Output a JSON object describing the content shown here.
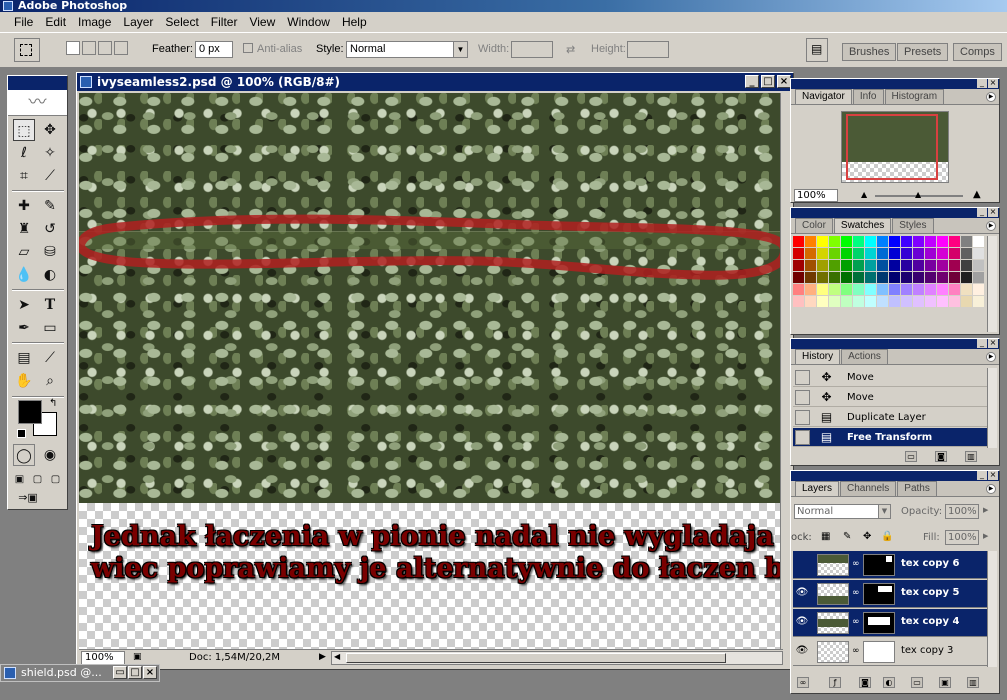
{
  "app": {
    "title": "Adobe Photoshop"
  },
  "menu": [
    "File",
    "Edit",
    "Image",
    "Layer",
    "Select",
    "Filter",
    "View",
    "Window",
    "Help"
  ],
  "options": {
    "feather_label": "Feather:",
    "feather_value": "0 px",
    "antialias_label": "Anti-alias",
    "style_label": "Style:",
    "style_value": "Normal",
    "width_label": "Width:",
    "height_label": "Height:",
    "well_tabs": [
      "Brushes",
      "Presets",
      "Comps"
    ]
  },
  "document": {
    "title": "ivyseamless2.psd @ 100% (RGB/8#)",
    "caption_line1": "Jednak łaczenia w pionie nadal nie wygladaja dobrze",
    "caption_line2": "wiec poprawiamy je alternatywnie do łaczen bocznych",
    "zoom": "100%",
    "doc_info": "Doc: 1,54M/20,2M"
  },
  "navigator": {
    "tabs": [
      "Navigator",
      "Info",
      "Histogram"
    ],
    "zoom": "100%"
  },
  "swatches": {
    "tabs": [
      "Color",
      "Swatches",
      "Styles"
    ],
    "colors": [
      "#ff0000",
      "#ff8000",
      "#ffff00",
      "#80ff00",
      "#00ff00",
      "#00ff80",
      "#00ffff",
      "#0080ff",
      "#0000ff",
      "#4000ff",
      "#8000ff",
      "#c000ff",
      "#ff00ff",
      "#ff0080",
      "#808080",
      "#ffffff",
      "#d40000",
      "#d46a00",
      "#d4d400",
      "#6ad400",
      "#00d400",
      "#00d46a",
      "#00d4d4",
      "#006ad4",
      "#0000d4",
      "#3500d4",
      "#6a00d4",
      "#a000d4",
      "#d400d4",
      "#d4006a",
      "#606060",
      "#e0e0e0",
      "#a00000",
      "#a05000",
      "#a0a000",
      "#50a000",
      "#00a000",
      "#00a050",
      "#00a0a0",
      "#0050a0",
      "#0000a0",
      "#2800a0",
      "#5000a0",
      "#7800a0",
      "#a000a0",
      "#a00050",
      "#404040",
      "#c0c0c0",
      "#700000",
      "#703800",
      "#707000",
      "#387000",
      "#007000",
      "#007038",
      "#007070",
      "#003870",
      "#000070",
      "#1c0070",
      "#380070",
      "#540070",
      "#700070",
      "#700038",
      "#202020",
      "#a0a0a0",
      "#ff8080",
      "#ffb080",
      "#ffff80",
      "#c0ff80",
      "#80ff80",
      "#80ffc0",
      "#80ffff",
      "#80c0ff",
      "#8080ff",
      "#a080ff",
      "#c080ff",
      "#e080ff",
      "#ff80ff",
      "#ff80c0",
      "#f0e0c0",
      "#fff0e0",
      "#ffc0c0",
      "#ffd8c0",
      "#ffffc0",
      "#e0ffc0",
      "#c0ffc0",
      "#c0ffe0",
      "#c0ffff",
      "#c0e0ff",
      "#c0c0ff",
      "#d0c0ff",
      "#e0c0ff",
      "#f0c0ff",
      "#ffc0ff",
      "#ffc0e0",
      "#e8d8b0",
      "#f8f0d8"
    ]
  },
  "history": {
    "tabs": [
      "History",
      "Actions"
    ],
    "items": [
      {
        "label": "Move",
        "selected": false
      },
      {
        "label": "Move",
        "selected": false
      },
      {
        "label": "Duplicate Layer",
        "selected": false
      },
      {
        "label": "Free Transform",
        "selected": true
      }
    ]
  },
  "layers": {
    "tabs": [
      "Layers",
      "Channels",
      "Paths"
    ],
    "blend_mode": "Normal",
    "opacity_label": "Opacity:",
    "opacity_value": "100%",
    "lock_label": "ock:",
    "fill_label": "Fill:",
    "fill_value": "100%",
    "items": [
      {
        "name": "tex copy 6",
        "selected": true
      },
      {
        "name": "tex copy 5",
        "selected": true
      },
      {
        "name": "tex copy 4",
        "selected": true
      },
      {
        "name": "tex copy 3",
        "selected": false
      }
    ]
  },
  "taskbar": {
    "doc_title": "shield.psd @..."
  },
  "colors": {
    "title_blue": "#0a246a",
    "chrome": "#d4d0c8",
    "workspace": "#808080",
    "loop_red": "#b02020",
    "caption_red": "#7a0000"
  }
}
